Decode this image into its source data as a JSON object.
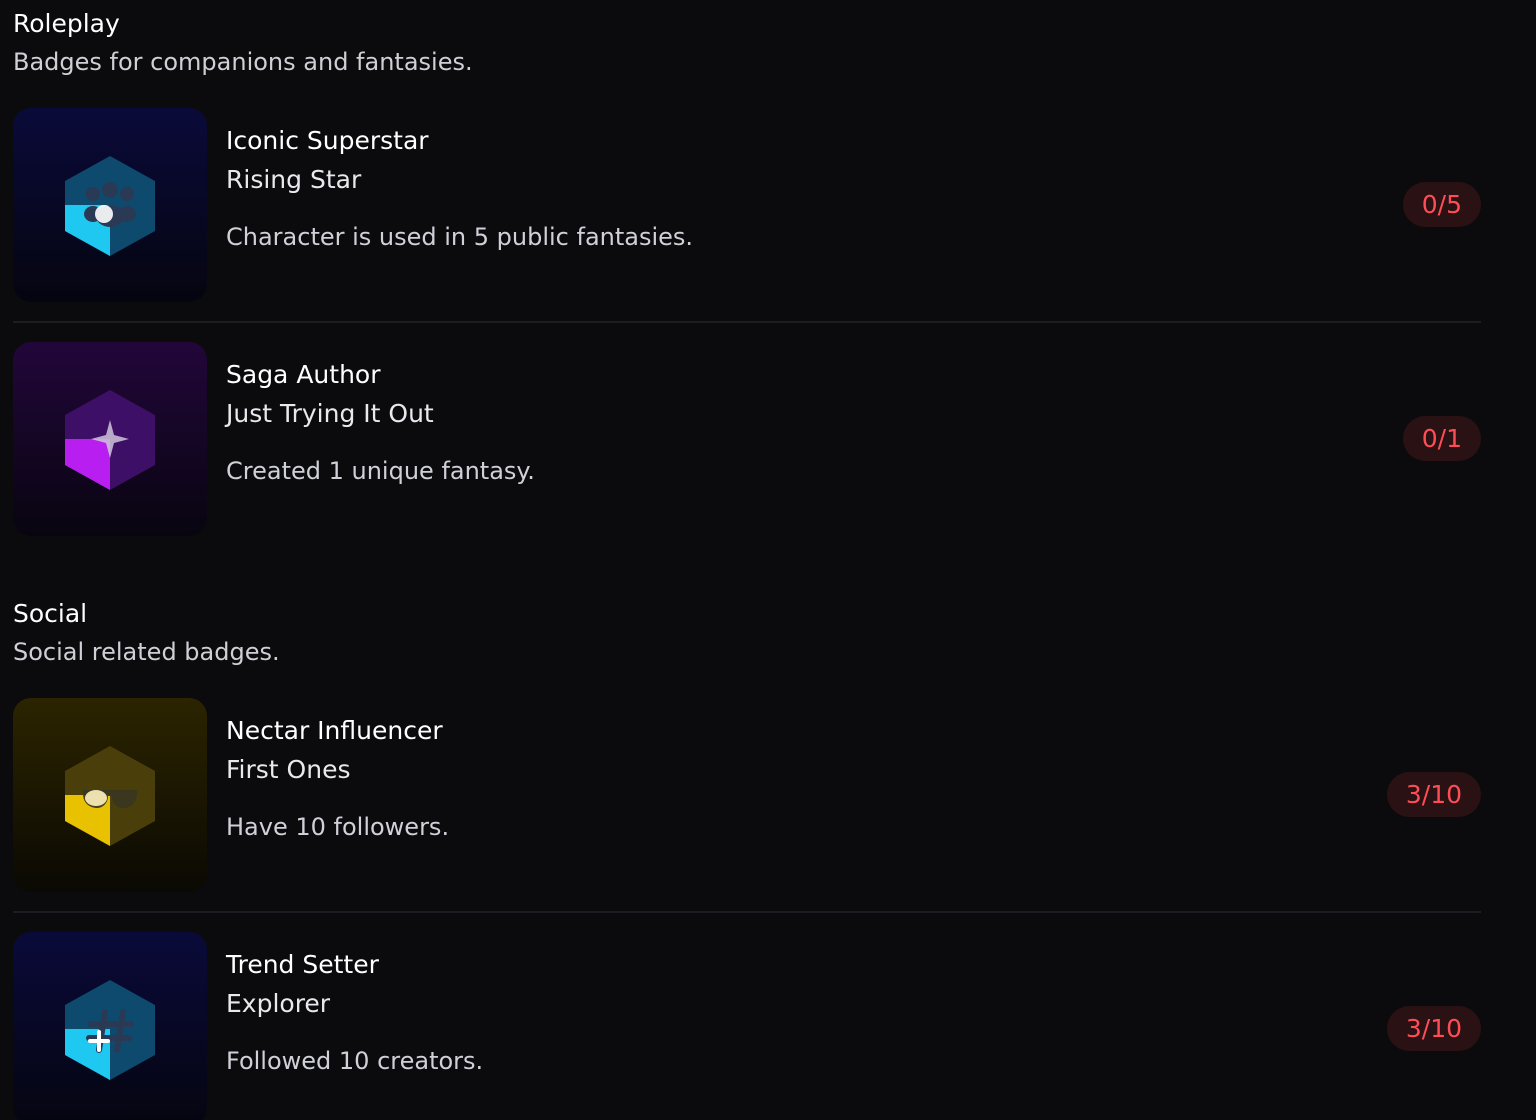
{
  "sections": [
    {
      "title": "Roleplay",
      "description": "Badges for companions and fantasies.",
      "badges": [
        {
          "name": "Iconic Superstar",
          "tier": "Rising Star",
          "description": "Character is used in 5 public fantasies.",
          "progress": "0/5",
          "icon": "group-people-icon",
          "color": "#1ec8f0"
        },
        {
          "name": "Saga Author",
          "tier": "Just Trying It Out",
          "description": "Created 1 unique fantasy.",
          "progress": "0/1",
          "icon": "sparkle-icon",
          "color": "#b81ef0"
        }
      ]
    },
    {
      "title": "Social",
      "description": "Social related badges.",
      "badges": [
        {
          "name": "Nectar Influencer",
          "tier": "First Ones",
          "description": "Have 10 followers.",
          "progress": "3/10",
          "icon": "sunglasses-icon",
          "color": "#e8c200"
        },
        {
          "name": "Trend Setter",
          "tier": "Explorer",
          "description": "Followed 10 creators.",
          "progress": "3/10",
          "icon": "hashtag-icon",
          "color": "#1ec8f0"
        }
      ]
    }
  ],
  "colors": {
    "background": "#0b0b0d",
    "progress_text": "#ff4d55",
    "progress_bg": "#2a1114"
  }
}
